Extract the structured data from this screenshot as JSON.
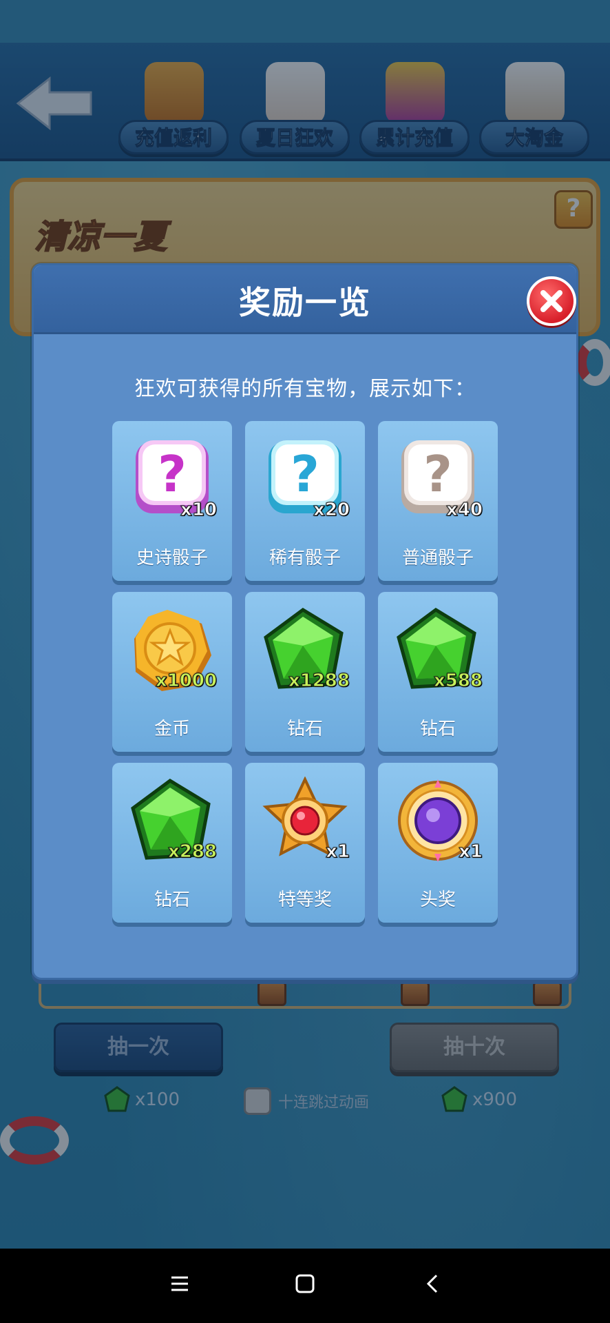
{
  "nav": {
    "tabs": [
      {
        "label": "充值返利"
      },
      {
        "label": "夏日狂欢"
      },
      {
        "label": "累计充值"
      },
      {
        "label": "大淘金"
      }
    ]
  },
  "banner": {
    "title": "清凉一夏"
  },
  "modal": {
    "title": "奖励一览",
    "subtitle": "狂欢可获得的所有宝物，展示如下：",
    "rewards": [
      {
        "name": "史诗骰子",
        "qty": "x10",
        "icon": "purple-dice-question-icon"
      },
      {
        "name": "稀有骰子",
        "qty": "x20",
        "icon": "blue-dice-question-icon"
      },
      {
        "name": "普通骰子",
        "qty": "x40",
        "icon": "white-dice-question-icon"
      },
      {
        "name": "金币",
        "qty": "x1000",
        "icon": "gold-coin-icon"
      },
      {
        "name": "钻石",
        "qty": "x1288",
        "icon": "green-diamond-icon"
      },
      {
        "name": "钻石",
        "qty": "x588",
        "icon": "green-diamond-icon"
      },
      {
        "name": "钻石",
        "qty": "x288",
        "icon": "green-diamond-icon"
      },
      {
        "name": "特等奖",
        "qty": "x1",
        "icon": "red-gem-medal-icon"
      },
      {
        "name": "头奖",
        "qty": "x1",
        "icon": "purple-gem-medal-icon"
      }
    ]
  },
  "actions": {
    "draw_once": "抽一次",
    "draw_ten": "抽十次",
    "cost_once": "x100",
    "cost_ten": "x900",
    "skip_animation": "十连跳过动画"
  },
  "colors": {
    "modal_bg": "#5b8dc8",
    "card_bg": "#8ec6ef",
    "close_red": "#d81f2a",
    "qty_green": "#c8f25a"
  }
}
